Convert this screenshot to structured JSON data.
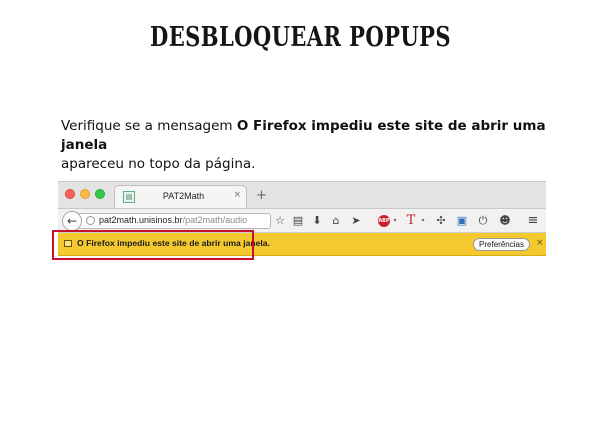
{
  "slide": {
    "title": "DESBLOQUEAR POPUPS",
    "text_before": "Verifique se a mensagem ",
    "text_bold": "O Firefox impediu este site de abrir uma janela",
    "text_after": "apareceu no topo da página."
  },
  "browser": {
    "tab_title": "PAT2Math",
    "tab_close": "×",
    "new_tab": "+",
    "url_host": "pat2math.unisinos.br",
    "url_path": "/pat2math/audio",
    "back_glyph": "←",
    "toolbar_icons": [
      "star-icon",
      "clipboard-icon",
      "download-icon",
      "home-icon",
      "send-icon",
      "adblock-plus-icon",
      "text-t-icon",
      "puzzle-icon",
      "chat-icon",
      "power-icon",
      "smiley-icon",
      "menu-icon"
    ],
    "adblock_label": "ABP",
    "notification_text": "O Firefox impediu este site de abrir uma janela.",
    "preferences_label": "Preferências",
    "notification_close": "×"
  },
  "colors": {
    "traffic_red": "#fc605c",
    "traffic_yellow": "#fdbc40",
    "traffic_green": "#34c84a",
    "notification_bar": "#f3c92f",
    "highlight": "#c8102e"
  }
}
